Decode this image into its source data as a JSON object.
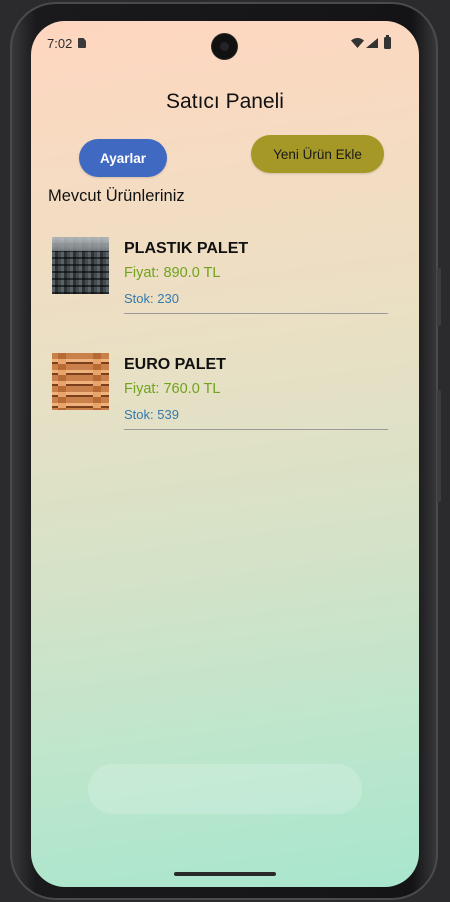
{
  "status_bar": {
    "time": "7:02",
    "icons": [
      "sim-card-icon",
      "wifi-icon",
      "signal-icon",
      "battery-icon"
    ]
  },
  "page": {
    "title": "Satıcı Paneli"
  },
  "actions": {
    "settings_label": "Ayarlar",
    "add_product_label": "Yeni Ürün Ekle"
  },
  "colors": {
    "settings_button": "#4069c1",
    "add_button": "#a59826",
    "price_text": "#6fa31d",
    "stock_text": "#3579ad"
  },
  "products": {
    "section_title": "Mevcut Ürünleriniz",
    "items": [
      {
        "name": "PLASTIK PALET",
        "price": "Fiyat: 890.0 TL",
        "stock": "Stok: 230",
        "image": "plastic-pallet-photo"
      },
      {
        "name": "EURO PALET",
        "price": "Fiyat: 760.0 TL",
        "stock": "Stok: 539",
        "image": "wooden-euro-pallet-photo"
      }
    ]
  }
}
